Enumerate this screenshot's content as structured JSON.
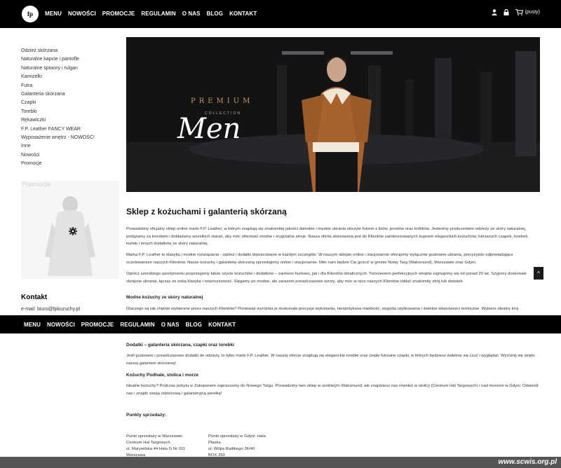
{
  "header": {
    "logo_text": "fp",
    "nav": [
      "MENU",
      "NOWOŚCI",
      "PROMOCJE",
      "REGULAMIN",
      "O NAS",
      "BLOG",
      "KONTAKT"
    ],
    "cart_text": "(pusty)",
    "icons": [
      "user-icon",
      "lock-icon",
      "cart-icon"
    ]
  },
  "sidebar": {
    "categories": [
      "Odzież skórzana",
      "Naturalne kapcie i pantofle",
      "Naturalne śpiwory i rulgan",
      "Kamizelki",
      "Futra",
      "Galanteria skórzana",
      "Czapki",
      "Torebki",
      "Rękawiczki",
      "F.P. Leather FANCY WEAR",
      "Wyposażenie wnętrz - NOWOŚĆ!",
      "Inne",
      "Nowości",
      "Promocje"
    ],
    "promo_label": "Promocje",
    "contact_title": "Kontakt",
    "contact_email": "e-mail: biuro@fpkozuchy.pl"
  },
  "banner": {
    "premium": "PREMIUM",
    "collection": "COLLECTION",
    "men": "Men"
  },
  "content": {
    "heading": "Sklep z kożuchami i galanterią skórzaną",
    "p1": "Prowadzimy oficjalny sklep online marki F.P. Leather, w którym znajdują się znakomitej jakości damskie i męskie ubrania obszyte futrem z lisów, jenotów oraz królików. Jesteśmy producentem odzieży ze skóry naturalnej, podążamy za trendami i dokładamy wszelkich starań, aby móc oferować modne i oryginalne stroje. Nasza oferta skierowana jest do Klientów zainteresowanych kupnem eleganckich kożuchów, futrzanych czapek, torebek, kurtek i innych dodatków ze skóry naturalnej.",
    "p2": "Marka F.P. Leather to klasyka i modne rozwiązania - odzież i dodatki dopracowane w każdym szczególe. W naszym sklepie online i stacjonarnie oferujemy wyłącznie gustowne ubrania, precyzyjnie odpowiadające oczekiwaniom naszych Klientów. Nasze kożuchy i galanterię skórzaną sprzedajemy online i stacjonarnie. Miło nam będzie Cię gościć w gminie Nowy Targ (Waksmund), Warszawie oraz Gdyni.",
    "p3": "Oprócz szerokiego asortymentu proponujemy także szycie kożuchów i dodatków – zarówno hurtowo, jak i dla Klientów detalicznych. Tworzeniem perfekcyjnych strojów zajmujemy się od ponad 20 lat. Szyjemy doskonale skrojone ubrania, łącząc ze sobą klasykę i nowoczesność. Sięgamy po modne, ale zarazem ponadczasowe wzory, aby móc w ręce naszych Klientów oddać znakomity strój lub dodatek.",
    "sub1": "Modne kożuchy ze skóry naturalnej",
    "p4": "Dlaczego są tak chętnie wybierane przez naszych Klientów? Ponieważ wyróżnia je doskonała precyzja wykonania, niespotykana miękkość, wygoda użytkowania i świetne właściwości termiczne. Wybierz idealny kroj",
    "sub2": "Dodatki – galanteria skórzana, czapki oraz torebki",
    "p5": "Jeśli gustowne i ponadczasowe dodatki do odzieży, to tylko marki F.P. Leather. W naszej ofercie znajdują się eleganckie torebki oraz ciepłe futrzane czapki, w których będziesz świetnie się czuć i wyglądać. Wyróżnij się dzięki naszej galanterii skórzanej!",
    "sub3": "Kożuchy Podhale, stolica i morze",
    "p6": "Idealne kożuchy? Podczas pobytu w Zakopanem zapraszamy do Nowego Targu. Prowadzimy tam sklep w urokliwym Waksmund, ale znajdziesz nas również w stolicy (Centrum Hal Targowych) i nad morzem w Gdyni. Odwiedź nas i znajdź swoją odzieżową i galanteryjną perełkę!",
    "sub4": "Punkty sprzedaży:",
    "warsaw": [
      "Punkt sprzedaży w Warszawie:",
      "Centrum Hal Targowych",
      "ul. Marywilska 44 Hala G Nr 011",
      "Warszawa"
    ],
    "gdynia": [
      "Punkt sprzedaży w Gdyni: Hala",
      "Płaska",
      "ul. Wójta Radtkego 36/40",
      "BOX 250"
    ]
  },
  "sticky_nav": [
    "MENU",
    "NOWOŚCI",
    "PROMOCJE",
    "REGULAMIN",
    "O NAS",
    "BLOG",
    "KONTAKT"
  ],
  "scroll_top": "^",
  "watermark": "www.scwis.org.pl",
  "colors": {
    "topbar": "#000000",
    "accent_gold": "#c79a50",
    "jacket": "#a8622d"
  }
}
